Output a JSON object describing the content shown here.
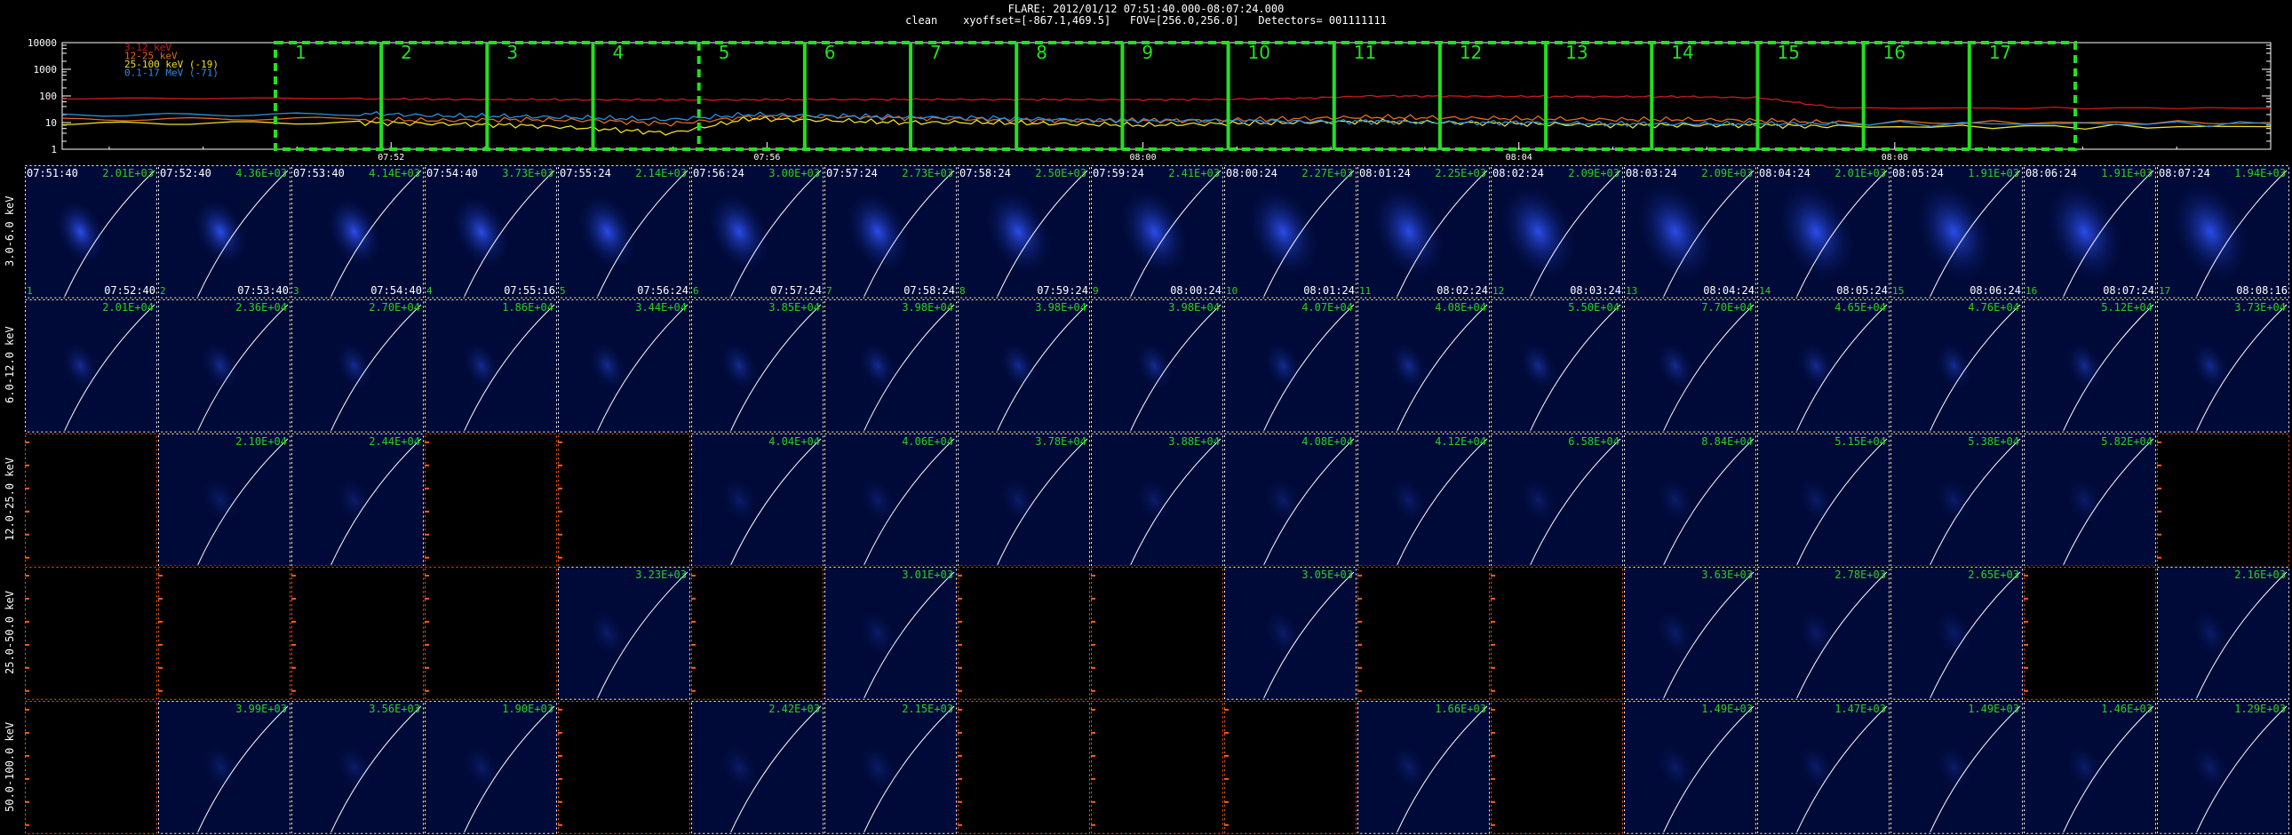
{
  "header": {
    "line1": "FLARE: 2012/01/12 07:51:40.000-08:07:24.000",
    "line2": "clean    xyoffset=[-867.1,469.5]   FOV=[256.0,256.0]   Detectors= 001111111"
  },
  "colors": {
    "band_3_12": "#d01a1a",
    "band_12_25": "#e36b1c",
    "band_25_100": "#f0e020",
    "band_0_1_17": "#2a8fe0",
    "box_green": "#22e01f",
    "value_green": "#29d11f",
    "cell_blue": "#000a38",
    "orange_axis": "#ff5a14"
  },
  "lightcurve": {
    "y_ticks": [
      "10000",
      "1000",
      "100",
      "10",
      "1"
    ],
    "x_ticks": [
      "07:52",
      "07:56",
      "08:00",
      "08:04",
      "08:08"
    ],
    "legend": [
      {
        "label": "3-12 keV",
        "color": "#d01a1a"
      },
      {
        "label": "12-25 keV",
        "color": "#e36b1c"
      },
      {
        "label": "25-100 keV (-19)",
        "color": "#f0e020"
      },
      {
        "label": "0.1-17 MeV (-71)",
        "color": "#2a8fe0"
      }
    ],
    "interval_numbers": [
      "1",
      "2",
      "3",
      "4",
      "5",
      "6",
      "7",
      "8",
      "9",
      "10",
      "11",
      "12",
      "13",
      "14",
      "15",
      "16",
      "17"
    ]
  },
  "chart_data": {
    "type": "line",
    "title": "FLARE: 2012/01/12 07:51:40.000-08:07:24.000",
    "x_range": [
      "07:51:40",
      "08:07:24"
    ],
    "ylim": [
      1,
      10000
    ],
    "y_scale": "log",
    "legend_position": "top-left",
    "series": [
      {
        "name": "3-12 keV",
        "color": "#d01a1a",
        "values": [
          78,
          75,
          73,
          72,
          71,
          72,
          73,
          74,
          73,
          73,
          72,
          74,
          80,
          100,
          98,
          96,
          95,
          94,
          85,
          35
        ]
      },
      {
        "name": "12-25 keV",
        "color": "#e36b1c",
        "values": [
          13,
          12,
          13,
          12,
          9,
          16,
          17,
          15,
          13,
          12,
          12,
          12,
          14,
          16,
          15,
          14,
          13,
          13,
          12,
          10
        ]
      },
      {
        "name": "25-100 keV (-19)",
        "color": "#f0e020",
        "values": [
          10,
          9,
          8,
          6,
          4,
          14,
          12,
          10,
          10,
          9,
          8,
          9,
          10,
          11,
          10,
          9,
          8,
          8,
          8,
          7
        ]
      },
      {
        "name": "0.1-17 MeV (-71)",
        "color": "#2a8fe0",
        "values": [
          22,
          18,
          17,
          15,
          13,
          20,
          18,
          16,
          15,
          13,
          12,
          12,
          11,
          11,
          10,
          10,
          9,
          9,
          9,
          9
        ]
      }
    ]
  },
  "grid": {
    "row_labels": [
      "3.0-6.0 keV",
      "6.0-12.0 keV",
      "12.0-25.0 keV",
      "25.0-50.0 keV",
      "50.0-100.0 keV"
    ],
    "start_times": [
      "07:51:40",
      "07:52:40",
      "07:53:40",
      "07:54:40",
      "07:55:24",
      "07:56:24",
      "07:57:24",
      "07:58:24",
      "07:59:24",
      "08:00:24",
      "08:01:24",
      "08:02:24",
      "08:03:24",
      "08:04:24",
      "08:05:24",
      "08:06:24",
      "08:07:24"
    ],
    "end_times": [
      "07:52:40",
      "07:53:40",
      "07:54:40",
      "07:55:16",
      "07:56:24",
      "07:57:24",
      "07:58:24",
      "07:59:24",
      "08:00:24",
      "08:01:24",
      "08:02:24",
      "08:03:24",
      "08:04:24",
      "08:05:24",
      "08:06:24",
      "08:07:24",
      "08:08:16"
    ],
    "values": [
      [
        "2.01E+03",
        "4.36E+03",
        "4.14E+03",
        "3.73E+03",
        "2.14E+03",
        "3.00E+03",
        "2.73E+03",
        "2.50E+03",
        "2.41E+03",
        "2.27E+03",
        "2.25E+03",
        "2.09E+03",
        "2.09E+03",
        "2.01E+03",
        "1.91E+03",
        "1.91E+03",
        "1.94E+03"
      ],
      [
        "2.01E+04",
        "2.36E+04",
        "2.70E+04",
        "1.86E+04",
        "3.44E+04",
        "3.85E+04",
        "3.98E+04",
        "3.98E+04",
        "3.98E+04",
        "4.07E+04",
        "4.08E+04",
        "5.50E+04",
        "7.70E+04",
        "4.65E+04",
        "4.76E+04",
        "5.12E+04",
        "3.73E+04"
      ],
      [
        "",
        "2.10E+04",
        "2.44E+04",
        "",
        "",
        "4.04E+04",
        "4.06E+04",
        "3.78E+04",
        "3.88E+04",
        "4.08E+04",
        "4.12E+04",
        "6.58E+04",
        "8.84E+04",
        "5.15E+04",
        "5.38E+04",
        "5.82E+04",
        ""
      ],
      [
        "",
        "",
        "",
        "",
        "3.23E+03",
        "",
        "3.01E+03",
        "",
        "",
        "3.05E+03",
        "",
        "",
        "3.63E+03",
        "2.78E+03",
        "2.65E+03",
        "",
        "2.16E+03"
      ],
      [
        "",
        "3.99E+03",
        "3.56E+03",
        "1.90E+03",
        "",
        "2.42E+03",
        "2.15E+03",
        "",
        "",
        "",
        "1.66E+03",
        "",
        "1.49E+03",
        "1.47E+03",
        "1.49E+03",
        "1.46E+03",
        "1.29E+03"
      ]
    ]
  }
}
